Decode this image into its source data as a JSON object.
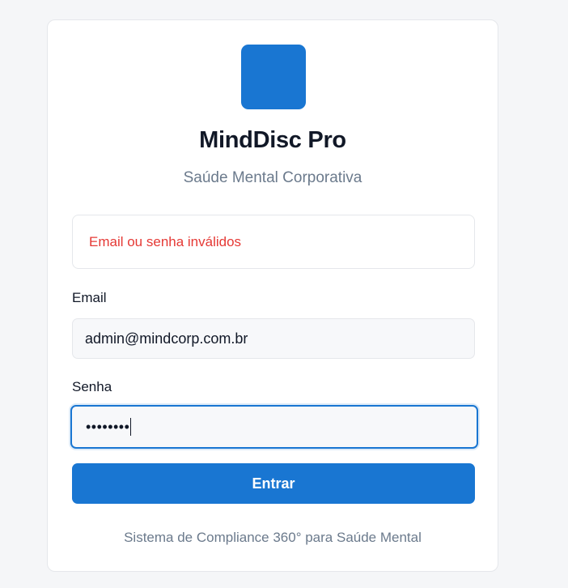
{
  "app": {
    "title": "MindDisc Pro",
    "subtitle": "Saúde Mental Corporativa"
  },
  "login": {
    "error_message": "Email ou senha inválidos",
    "email_label": "Email",
    "email_value": "admin@mindcorp.com.br",
    "password_label": "Senha",
    "password_masked": "••••••••",
    "submit_label": "Entrar"
  },
  "footer": {
    "text": "Sistema de Compliance 360° para Saúde Mental"
  },
  "colors": {
    "brand": "#1976d2",
    "error": "#e53935"
  }
}
